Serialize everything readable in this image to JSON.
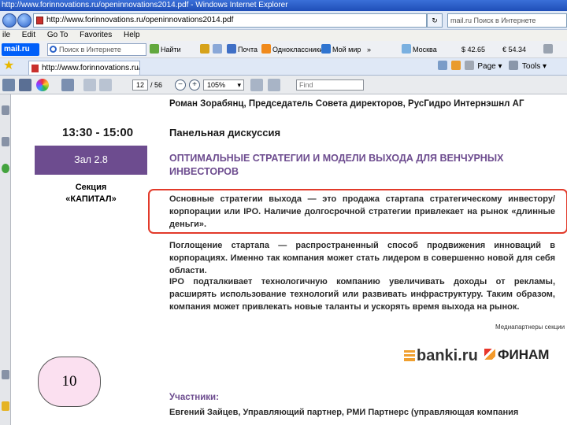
{
  "window": {
    "title": "http://www.forinnovations.ru/openinnovations2014.pdf - Windows Internet Explorer"
  },
  "address_bar": {
    "url": "http://www.forinnovations.ru/openinnovations2014.pdf",
    "search_placeholder": "mail.ru Поиск в Интернете"
  },
  "menu": [
    "ile",
    "Edit",
    "Go To",
    "Favorites",
    "Help"
  ],
  "toolbar": {
    "brand": "mail.ru",
    "search_placeholder": "Поиск в Интернете",
    "find_button": "Найти",
    "items": [
      "Почта",
      "Одноклассники",
      "Мой мир"
    ],
    "more": "»",
    "weather": "Москва",
    "rate_usd": "$ 42.65",
    "rate_eur": "€ 54.34"
  },
  "tab": {
    "title": "http://www.forinnovations.ru/openinnovations2014.pdf"
  },
  "page_tools": {
    "page": "Page",
    "tools": "Tools"
  },
  "pdf_toolbar": {
    "current_page": "12",
    "page_count": "/ 56",
    "zoom": "105%",
    "find_placeholder": "Find"
  },
  "document": {
    "speaker_top": "Роман Зорабянц, Председатель Совета директоров, РусГидро Интернэшнл АГ",
    "time": "13:30 - 15:00",
    "hall": "Зал 2.8",
    "section_label_1": "Секция",
    "section_label_2": "«КАПИТАЛ»",
    "panel_title": "Панельная дискуссия",
    "headline": "ОПТИМАЛЬНЫЕ СТРАТЕГИИ И МОДЕЛИ ВЫХОДА ДЛЯ ВЕНЧУРНЫХ ИНВЕСТОРОВ",
    "paragraph_1": "Основные стратегии выхода — это продажа стартапа стратегическому инвестору/корпорации или IPO. Наличие долгосрочной стратегии привлекает на рынок «длинные деньги».",
    "paragraph_2": "Поглощение стартапа — распространенный способ продвижения инноваций в корпорациях. Именно так компания может стать лидером в совершенно новой для себя области.",
    "paragraph_3": "IPO подталкивает технологичную компанию увеличивать доходы от рекламы, расширять использование технологий или развивать инфраструктуру. Таким образом, компания может привлекать новые таланты и ускорять время выхода на рынок.",
    "media_partners": "Медиапартнеры секции",
    "logo_banki": "banki.ru",
    "logo_finam": "ФИНАМ",
    "participants_heading": "Участники:",
    "participant_1": "Евгений Зайцев, Управляющий партнер, РМИ Партнерс (управляющая компания"
  },
  "slide_number": "10",
  "colors": {
    "accent_purple": "#6d4c8f",
    "highlight_red": "#e23a2a",
    "badge_pink": "#fbe0f0"
  }
}
